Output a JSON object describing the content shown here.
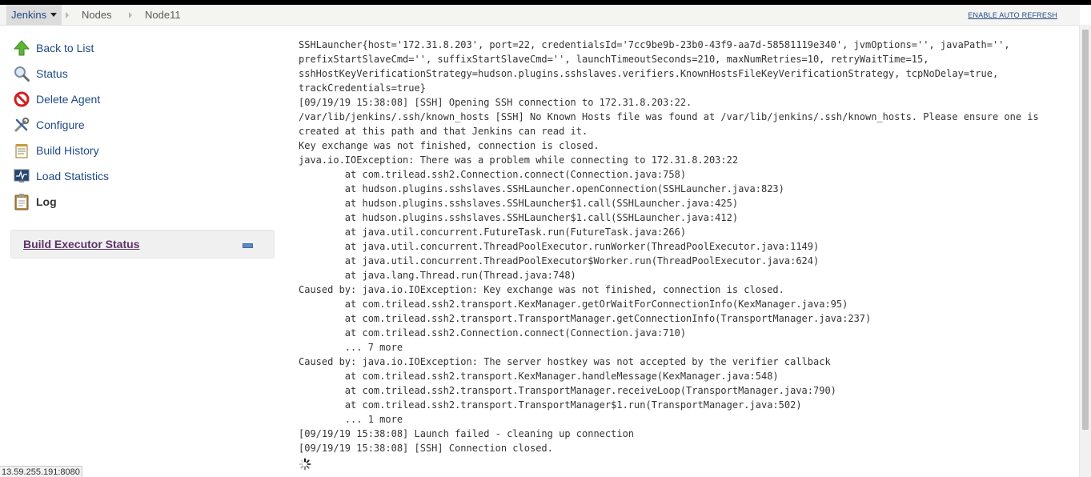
{
  "breadcrumb": {
    "items": [
      "Jenkins",
      "Nodes",
      "Node11"
    ],
    "auto_refresh_label": "ENABLE AUTO REFRESH"
  },
  "sidebar": {
    "items": [
      {
        "label": "Back to List",
        "icon": "up-arrow-icon"
      },
      {
        "label": "Status",
        "icon": "magnifier-icon"
      },
      {
        "label": "Delete Agent",
        "icon": "no-entry-icon"
      },
      {
        "label": "Configure",
        "icon": "tools-icon"
      },
      {
        "label": "Build History",
        "icon": "notepad-icon"
      },
      {
        "label": "Load Statistics",
        "icon": "monitor-graph-icon"
      },
      {
        "label": "Log",
        "icon": "clipboard-icon"
      }
    ]
  },
  "executor_panel": {
    "title": "Build Executor Status"
  },
  "log_lines": [
    "SSHLauncher{host='172.31.8.203', port=22, credentialsId='7cc9be9b-23b0-43f9-aa7d-58581119e340', jvmOptions='', javaPath='',",
    "prefixStartSlaveCmd='', suffixStartSlaveCmd='', launchTimeoutSeconds=210, maxNumRetries=10, retryWaitTime=15,",
    "sshHostKeyVerificationStrategy=hudson.plugins.sshslaves.verifiers.KnownHostsFileKeyVerificationStrategy, tcpNoDelay=true,",
    "trackCredentials=true}",
    "[09/19/19 15:38:08] [SSH] Opening SSH connection to 172.31.8.203:22.",
    "/var/lib/jenkins/.ssh/known_hosts [SSH] No Known Hosts file was found at /var/lib/jenkins/.ssh/known_hosts. Please ensure one is",
    "created at this path and that Jenkins can read it.",
    "Key exchange was not finished, connection is closed.",
    "java.io.IOException: There was a problem while connecting to 172.31.8.203:22",
    "\tat com.trilead.ssh2.Connection.connect(Connection.java:758)",
    "\tat hudson.plugins.sshslaves.SSHLauncher.openConnection(SSHLauncher.java:823)",
    "\tat hudson.plugins.sshslaves.SSHLauncher$1.call(SSHLauncher.java:425)",
    "\tat hudson.plugins.sshslaves.SSHLauncher$1.call(SSHLauncher.java:412)",
    "\tat java.util.concurrent.FutureTask.run(FutureTask.java:266)",
    "\tat java.util.concurrent.ThreadPoolExecutor.runWorker(ThreadPoolExecutor.java:1149)",
    "\tat java.util.concurrent.ThreadPoolExecutor$Worker.run(ThreadPoolExecutor.java:624)",
    "\tat java.lang.Thread.run(Thread.java:748)",
    "Caused by: java.io.IOException: Key exchange was not finished, connection is closed.",
    "\tat com.trilead.ssh2.transport.KexManager.getOrWaitForConnectionInfo(KexManager.java:95)",
    "\tat com.trilead.ssh2.transport.TransportManager.getConnectionInfo(TransportManager.java:237)",
    "\tat com.trilead.ssh2.Connection.connect(Connection.java:710)",
    "\t... 7 more",
    "Caused by: java.io.IOException: The server hostkey was not accepted by the verifier callback",
    "\tat com.trilead.ssh2.transport.KexManager.handleMessage(KexManager.java:548)",
    "\tat com.trilead.ssh2.transport.TransportManager.receiveLoop(TransportManager.java:790)",
    "\tat com.trilead.ssh2.transport.TransportManager$1.run(TransportManager.java:502)",
    "\t... 1 more",
    "[09/19/19 15:38:08] Launch failed - cleaning up connection",
    "[09/19/19 15:38:08] [SSH] Connection closed."
  ],
  "status_bar": {
    "url": "13.59.255.191:8080"
  },
  "colors": {
    "link": "#204a87",
    "executor_title": "#5c3566",
    "breadcrumb_bg": "#f4f4f2"
  }
}
